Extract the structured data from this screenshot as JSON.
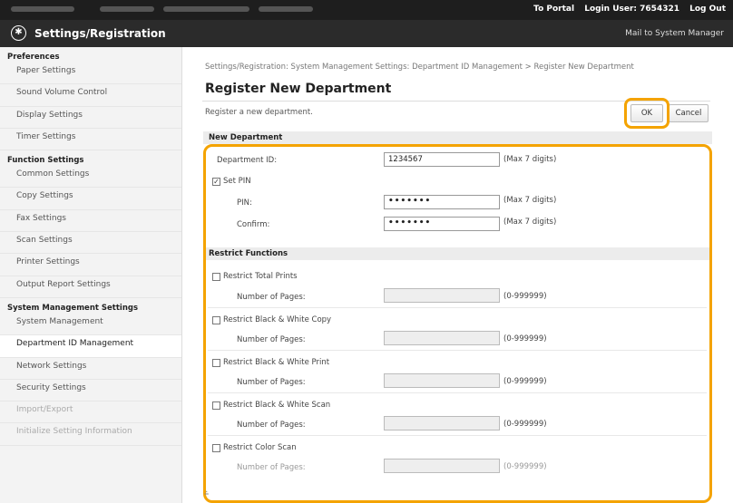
{
  "header": {
    "portal_label": "To Portal",
    "login_label": "Login User: 7654321",
    "logout_label": "Log Out",
    "app_title": "Settings/Registration",
    "mail_label": "Mail to System Manager"
  },
  "sidebar": {
    "preferences": {
      "title": "Preferences",
      "items": [
        "Paper Settings",
        "Sound Volume Control",
        "Display Settings",
        "Timer Settings"
      ]
    },
    "function": {
      "title": "Function Settings",
      "items": [
        "Common Settings",
        "Copy Settings",
        "Fax Settings",
        "Scan Settings",
        "Printer Settings",
        "Output Report Settings"
      ]
    },
    "system": {
      "title": "System Management Settings",
      "items": [
        "System Management",
        "Department ID Management",
        "Network Settings",
        "Security Settings",
        "Import/Export",
        "Initialize Setting Information"
      ]
    }
  },
  "main": {
    "breadcrumb": "Settings/Registration: System Management Settings: Department ID Management > Register New Department",
    "title": "Register New Department",
    "description": "Register a new department.",
    "ok_label": "OK",
    "cancel_label": "Cancel"
  },
  "new_dept": {
    "header": "New Department",
    "dept_id_label": "Department ID:",
    "dept_id_value": "1234567",
    "dept_id_hint": "(Max 7 digits)",
    "set_pin_label": "Set PIN",
    "set_pin_checked": true,
    "pin_label": "PIN:",
    "pin_value": "•••••••",
    "pin_hint": "(Max 7 digits)",
    "confirm_label": "Confirm:",
    "confirm_value": "•••••••",
    "confirm_hint": "(Max 7 digits)"
  },
  "restrict": {
    "header": "Restrict Functions",
    "pages_label": "Number of Pages:",
    "pages_hint": "(0-999999)",
    "items": [
      {
        "label": "Restrict Total Prints"
      },
      {
        "label": "Restrict Black & White Copy"
      },
      {
        "label": "Restrict Black & White Print"
      },
      {
        "label": "Restrict Black & White Scan"
      },
      {
        "label": "Restrict Color Scan"
      }
    ]
  },
  "colors": {
    "highlight": "#f4a300",
    "topbar": "#1e1e1e",
    "titlebar": "#2b2b2b"
  }
}
